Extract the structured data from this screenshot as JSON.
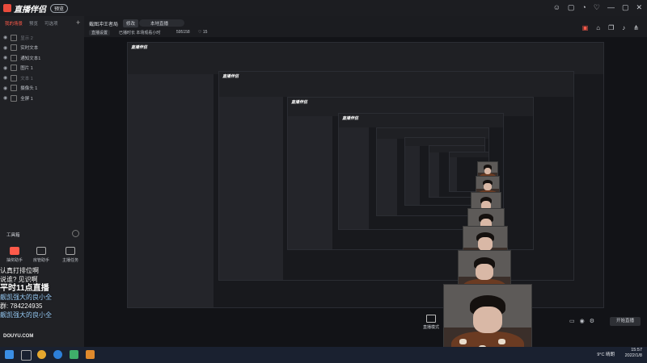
{
  "app": {
    "title": "直播伴侣",
    "badge": "预览"
  },
  "window_controls": [
    "☺",
    "▢",
    "◔",
    "♡",
    "—",
    "▢",
    "✕"
  ],
  "scenes": {
    "tabs": [
      "我的场景",
      "预览",
      "可选项"
    ],
    "add": "+",
    "sources": [
      {
        "label": "显示 2",
        "muted": true
      },
      {
        "label": "实时文本",
        "muted": false
      },
      {
        "label": "通知文本1",
        "muted": false
      },
      {
        "label": "图片 1",
        "muted": false
      },
      {
        "label": "文本 1",
        "muted": true
      },
      {
        "label": "摄像头 1",
        "muted": false
      },
      {
        "label": "全屏 1",
        "muted": false
      }
    ]
  },
  "toolbox": {
    "title": "工具箱",
    "tools": [
      {
        "label": "抽奖助手",
        "accent": "#ff5a4a"
      },
      {
        "label": "房管助手",
        "accent": "#cfd2d8"
      },
      {
        "label": "主播任务",
        "accent": "#cfd2d8"
      }
    ]
  },
  "toolbar": {
    "scene_name": "截图冲王者局",
    "edit": "修改",
    "mode": "本地直播",
    "stat1": "直播设置",
    "stat2": "已播时长 本场观看小时",
    "stat3": "595158",
    "stat4": "♡ 15"
  },
  "overlay": {
    "line1": "认真打排位啊",
    "line2": "说谁? 见识啊",
    "line3": "平时11点直播",
    "line4": "靓凯强大的良小全",
    "line5": "群: 784224935",
    "line6": "靓凯强大的良小全"
  },
  "douyin": "DOUYU.COM",
  "live_mode_label": "直播模式",
  "start_button": "开始直播",
  "taskbar": {
    "time": "15:57",
    "date": "2022/1/8",
    "weather": "9°C 晴朗"
  },
  "colors": {
    "accent": "#ff5a4a",
    "bg": "#101114",
    "panel": "#202125"
  }
}
